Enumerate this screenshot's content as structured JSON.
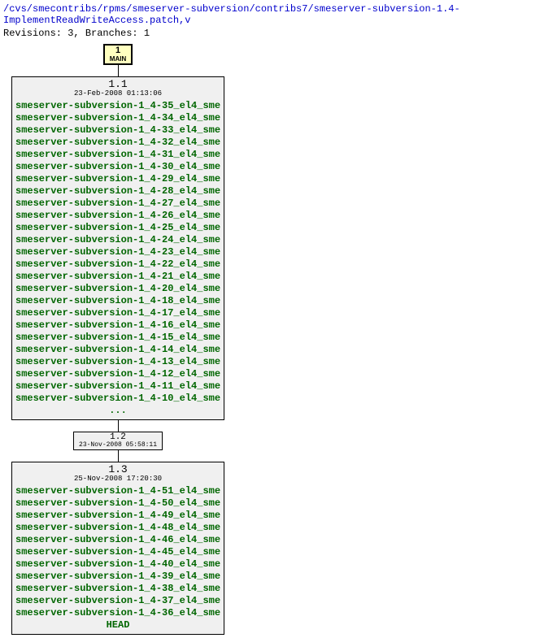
{
  "header": {
    "path": "/cvs/smecontribs/rpms/smeserver-subversion/contribs7/smeserver-subversion-1.4-ImplementReadWriteAccess.patch,v",
    "meta": "Revisions: 3, Branches: 1"
  },
  "branch": {
    "num": "1",
    "name": "MAIN"
  },
  "rev11": {
    "num": "1.1",
    "date": "23-Feb-2008 01:13:06",
    "ellipsis": "...",
    "tags": [
      "smeserver-subversion-1_4-35_el4_sme",
      "smeserver-subversion-1_4-34_el4_sme",
      "smeserver-subversion-1_4-33_el4_sme",
      "smeserver-subversion-1_4-32_el4_sme",
      "smeserver-subversion-1_4-31_el4_sme",
      "smeserver-subversion-1_4-30_el4_sme",
      "smeserver-subversion-1_4-29_el4_sme",
      "smeserver-subversion-1_4-28_el4_sme",
      "smeserver-subversion-1_4-27_el4_sme",
      "smeserver-subversion-1_4-26_el4_sme",
      "smeserver-subversion-1_4-25_el4_sme",
      "smeserver-subversion-1_4-24_el4_sme",
      "smeserver-subversion-1_4-23_el4_sme",
      "smeserver-subversion-1_4-22_el4_sme",
      "smeserver-subversion-1_4-21_el4_sme",
      "smeserver-subversion-1_4-20_el4_sme",
      "smeserver-subversion-1_4-18_el4_sme",
      "smeserver-subversion-1_4-17_el4_sme",
      "smeserver-subversion-1_4-16_el4_sme",
      "smeserver-subversion-1_4-15_el4_sme",
      "smeserver-subversion-1_4-14_el4_sme",
      "smeserver-subversion-1_4-13_el4_sme",
      "smeserver-subversion-1_4-12_el4_sme",
      "smeserver-subversion-1_4-11_el4_sme",
      "smeserver-subversion-1_4-10_el4_sme"
    ]
  },
  "rev12": {
    "num": "1.2",
    "date": "23-Nov-2008 05:58:11"
  },
  "rev13": {
    "num": "1.3",
    "date": "25-Nov-2008 17:20:30",
    "tags": [
      "smeserver-subversion-1_4-51_el4_sme",
      "smeserver-subversion-1_4-50_el4_sme",
      "smeserver-subversion-1_4-49_el4_sme",
      "smeserver-subversion-1_4-48_el4_sme",
      "smeserver-subversion-1_4-46_el4_sme",
      "smeserver-subversion-1_4-45_el4_sme",
      "smeserver-subversion-1_4-40_el4_sme",
      "smeserver-subversion-1_4-39_el4_sme",
      "smeserver-subversion-1_4-38_el4_sme",
      "smeserver-subversion-1_4-37_el4_sme",
      "smeserver-subversion-1_4-36_el4_sme"
    ],
    "head": "HEAD"
  }
}
